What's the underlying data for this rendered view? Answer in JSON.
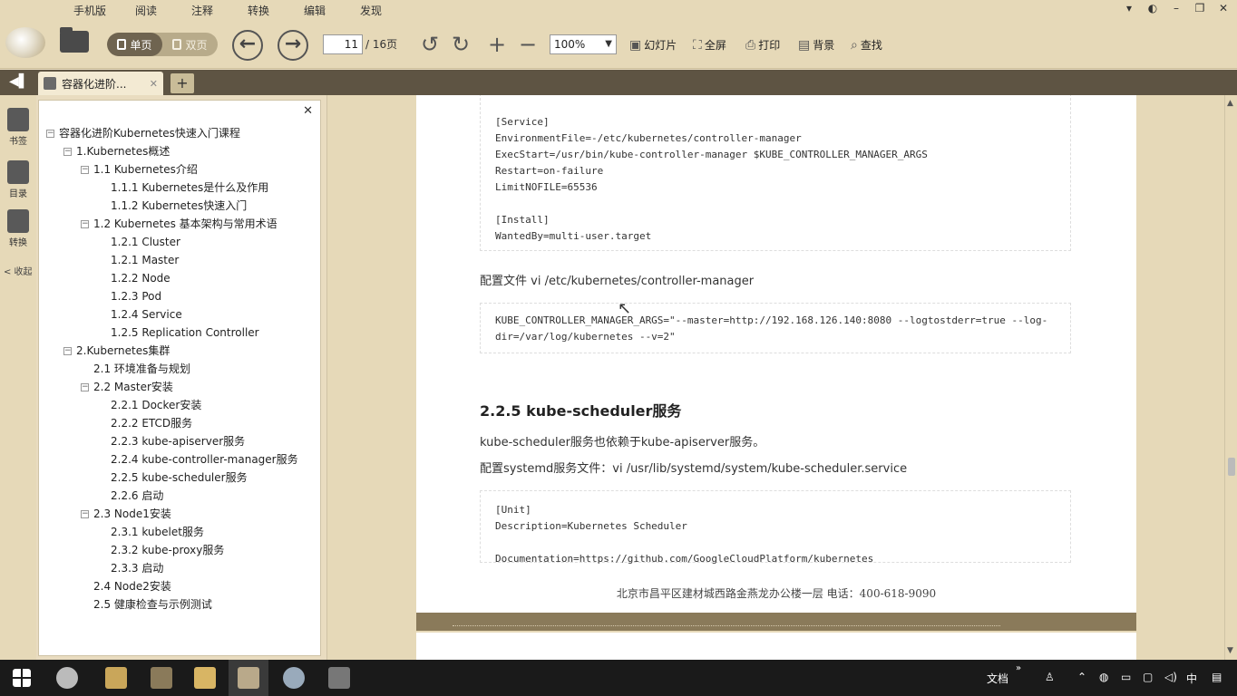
{
  "menu": {
    "items": [
      "手机版",
      "阅读",
      "注释",
      "转换",
      "编辑",
      "发现"
    ]
  },
  "toolbar": {
    "single_page": "单页",
    "double_page": "双页",
    "current_page": "11",
    "total_pages": "/ 16页",
    "zoom": "100%",
    "slideshow": "幻灯片",
    "fullscreen": "全屏",
    "print": "打印",
    "background": "背景",
    "search": "查找"
  },
  "tab": {
    "title": "容器化进阶..."
  },
  "rail": {
    "bookmarks": "书签",
    "contents": "目录",
    "convert": "转换",
    "collapse": "< 收起"
  },
  "outline": {
    "root": "容器化进阶Kubernetes快速入门课程",
    "nodes": [
      {
        "label": "1.Kubernetes概述"
      },
      {
        "label": "1.1 Kubernetes介绍"
      },
      {
        "label": "1.1.1 Kubernetes是什么及作用"
      },
      {
        "label": "1.1.2 Kubernetes快速入门"
      },
      {
        "label": "1.2 Kubernetes 基本架构与常用术语"
      },
      {
        "label": "1.2.1 Cluster"
      },
      {
        "label": "1.2.1 Master"
      },
      {
        "label": "1.2.2 Node"
      },
      {
        "label": "1.2.3 Pod"
      },
      {
        "label": "1.2.4 Service"
      },
      {
        "label": "1.2.5 Replication Controller"
      },
      {
        "label": "2.Kubernetes集群"
      },
      {
        "label": "2.1 环境准备与规划"
      },
      {
        "label": "2.2 Master安装"
      },
      {
        "label": "2.2.1 Docker安装"
      },
      {
        "label": "2.2.2 ETCD服务"
      },
      {
        "label": "2.2.3 kube-apiserver服务"
      },
      {
        "label": "2.2.4 kube-controller-manager服务"
      },
      {
        "label": "2.2.5 kube-scheduler服务"
      },
      {
        "label": "2.2.6 启动"
      },
      {
        "label": "2.3 Node1安装"
      },
      {
        "label": "2.3.1 kubelet服务"
      },
      {
        "label": "2.3.2 kube-proxy服务"
      },
      {
        "label": "2.3.3 启动"
      },
      {
        "label": "2.4 Node2安装"
      },
      {
        "label": "2.5 健康检查与示例测试"
      }
    ]
  },
  "document": {
    "code1": [
      "[Service]",
      "EnvironmentFile=-/etc/kubernetes/controller-manager",
      "ExecStart=/usr/bin/kube-controller-manager $KUBE_CONTROLLER_MANAGER_ARGS",
      "Restart=on-failure",
      "LimitNOFILE=65536",
      "",
      "[Install]",
      "WantedBy=multi-user.target"
    ],
    "para1": "配置文件 vi /etc/kubernetes/controller-manager",
    "code2": [
      "KUBE_CONTROLLER_MANAGER_ARGS=\"--master=http://192.168.126.140:8080 --logtostderr=true --log-",
      "dir=/var/log/kubernetes --v=2\""
    ],
    "heading": "2.2.5 kube-scheduler服务",
    "para2": "kube-scheduler服务也依赖于kube-apiserver服务。",
    "para3": "配置systemd服务文件：vi /usr/lib/systemd/system/kube-scheduler.service",
    "code3": [
      "[Unit]",
      "Description=Kubernetes Scheduler",
      "",
      "Documentation=https://github.com/GoogleCloudPlatform/kubernetes"
    ],
    "footer": "北京市昌平区建材城西路金燕龙办公楼一层      电话：400-618-9090"
  },
  "taskbar": {
    "docs_label": "文档",
    "ime": "中"
  }
}
